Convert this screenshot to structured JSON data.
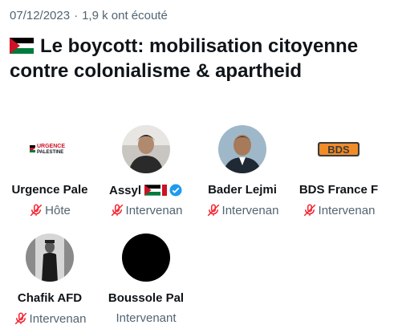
{
  "space": {
    "date": "07/12/2023",
    "separator": "·",
    "listeners": "1,9 k ont écouté",
    "title": "Le boycott: mobilisation citoyenne contre colonialisme & apartheid",
    "title_flag_icon": "palestine-flag-icon"
  },
  "speakers": [
    {
      "name": "Urgence Pale",
      "role": "Hôte",
      "muted": true,
      "avatar": "urgence-palestine-logo",
      "logo_text_1": "URGENCE",
      "logo_text_2": "PALESTINE"
    },
    {
      "name": "Assyl",
      "role": "Intervenan",
      "muted": true,
      "avatar": "person-photo",
      "badges": [
        "palestine-flag-icon",
        "verified-badge-icon"
      ]
    },
    {
      "name": "Bader Lejmi",
      "role": "Intervenan",
      "muted": true,
      "avatar": "person-photo"
    },
    {
      "name": "BDS France F",
      "role": "Intervenan",
      "muted": true,
      "avatar": "bds-logo",
      "logo_text": "BDS"
    },
    {
      "name": "Chafik AFD",
      "role": "Intervenan",
      "muted": true,
      "avatar": "person-photo"
    },
    {
      "name": "Boussole Pal",
      "role": "Intervenant",
      "muted": false,
      "avatar": "black-avatar"
    }
  ],
  "colors": {
    "text": "#0f1419",
    "secondary": "#536471",
    "muted_mic": "#f4212e",
    "verified": "#1d9bf0",
    "palestine_red": "#ce1126",
    "palestine_green": "#007a3d"
  }
}
